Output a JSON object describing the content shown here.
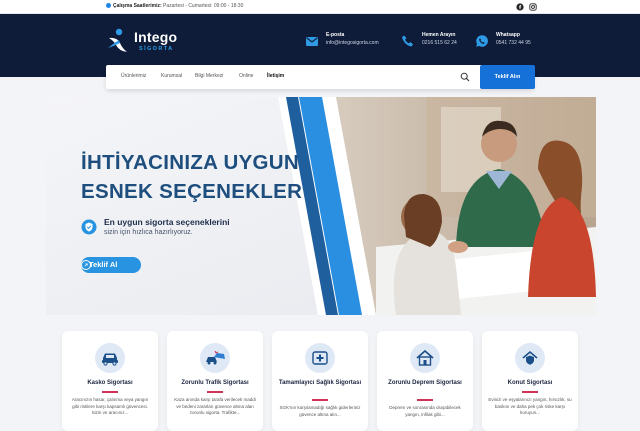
{
  "topbar": {
    "hours_label": "Çalışma Saatlerimiz:",
    "hours_value": "Pazartesi - Cumartesi: 09:00 - 18:30"
  },
  "header": {
    "brand_name": "Intego",
    "brand_sub": "SİGORTA",
    "contacts": [
      {
        "title": "E-posta",
        "value": "info@integosigorta.com",
        "icon": "mail-icon"
      },
      {
        "title": "Hemen Arayın",
        "value": "0216 515 62 24",
        "icon": "phone-icon"
      },
      {
        "title": "Whatsapp",
        "value": "0541 732 44 95",
        "icon": "whatsapp-icon"
      }
    ]
  },
  "nav": {
    "items": [
      "Ürünlerimiz",
      "Kurumsal",
      "Bilgi Merkezi",
      "Online",
      "İletişim"
    ],
    "active": "İletişim",
    "cta_label": "Teklif Alın"
  },
  "hero": {
    "headline_1": "İHTİYACINIZA UYGUN",
    "headline_2": "ESNEK SEÇENEKLER",
    "tagline_1": "En uygun sigorta seçeneklerini",
    "tagline_2": "sizin için hızlıca hazırlıyoruz.",
    "button_label": "Teklif Al"
  },
  "cards": [
    {
      "title": "Kasko Sigortası",
      "desc": "Aracınızın hasar, çalınma veya yangın gibi risklere karşı kapsamlı güvencesi. Sizin ve aracınız..."
    },
    {
      "title": "Zorunlu Trafik Sigortası",
      "desc": "Kaza anında karşı tarafa verilecek maddi ve bedeni zararları güvence altına alan zorunlu sigorta. Trafikte..."
    },
    {
      "title": "Tamamlayıcı Sağlık Sigortası",
      "desc": "SGK'nın karşılamadığı sağlık giderleriniz güvence altına alın..."
    },
    {
      "title": "Zorunlu Deprem Sigortası",
      "desc": "Deprem ve sonrasında oluşabilecek yangın, infilak gibi..."
    },
    {
      "title": "Konut Sigortası",
      "desc": "Evinizi ve eşyalarınızı yangın, hırsızlık, su baskını ve daha pek çok riske karşı koruyun..."
    }
  ],
  "colors": {
    "navy": "#0e1c39",
    "accent": "#1570d8",
    "light_blue": "#2893e0",
    "card_bar": "#d13357"
  }
}
